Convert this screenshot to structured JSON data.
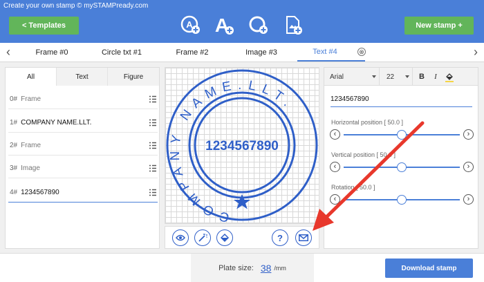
{
  "header": {
    "title": "Create your own stamp © mySTAMPready.com",
    "templates_label": "<  Templates",
    "new_stamp_label": "New stamp +",
    "tools": [
      "add-circle-text-icon",
      "add-text-icon",
      "add-circle-icon",
      "add-image-icon"
    ]
  },
  "tabs": [
    {
      "label": "Frame #0"
    },
    {
      "label": "Circle txt #1"
    },
    {
      "label": "Frame #2"
    },
    {
      "label": "Image #3"
    },
    {
      "label": "Text #4"
    }
  ],
  "tab_close_icon": "⊗",
  "left_panel": {
    "subtabs": [
      "All",
      "Text",
      "Figure"
    ],
    "layers": [
      {
        "index": "0#",
        "name": "Frame"
      },
      {
        "index": "1#",
        "name": "COMPANY NAME.LLT."
      },
      {
        "index": "2#",
        "name": "Frame"
      },
      {
        "index": "3#",
        "name": "Image"
      },
      {
        "index": "4#",
        "name": "1234567890"
      }
    ]
  },
  "stamp": {
    "circle_text": "COMPANY NAME.LLT.",
    "center_text": "1234567890",
    "color": "#2f5fc8"
  },
  "canvas_tools": {
    "preview_icon": "eye-icon",
    "effects_icon": "magic-wand-icon",
    "fill_icon": "paint-bucket-icon",
    "help_label": "?",
    "email_icon": "envelope-icon"
  },
  "right_panel": {
    "font": "Arial",
    "size": "22",
    "bold_label": "B",
    "italic_label": "I",
    "text_value": "1234567890",
    "sliders": [
      {
        "label": "Horizontal position [ 50.0 ]",
        "value": 50.0
      },
      {
        "label": "Vertical position [ 50.0 ]",
        "value": 50.0
      },
      {
        "label": "Rotation [ 50.0 ]",
        "value": 50.0
      }
    ]
  },
  "footer": {
    "plate_label": "Plate size:",
    "plate_value": "38",
    "plate_unit": "/mm",
    "download_label": "Download stamp"
  },
  "colors": {
    "header": "#4a7fd8",
    "green_button": "#62b55a",
    "accent": "#4a7fd8",
    "stamp": "#2f5fc8",
    "annotation_arrow": "#e8382c"
  }
}
